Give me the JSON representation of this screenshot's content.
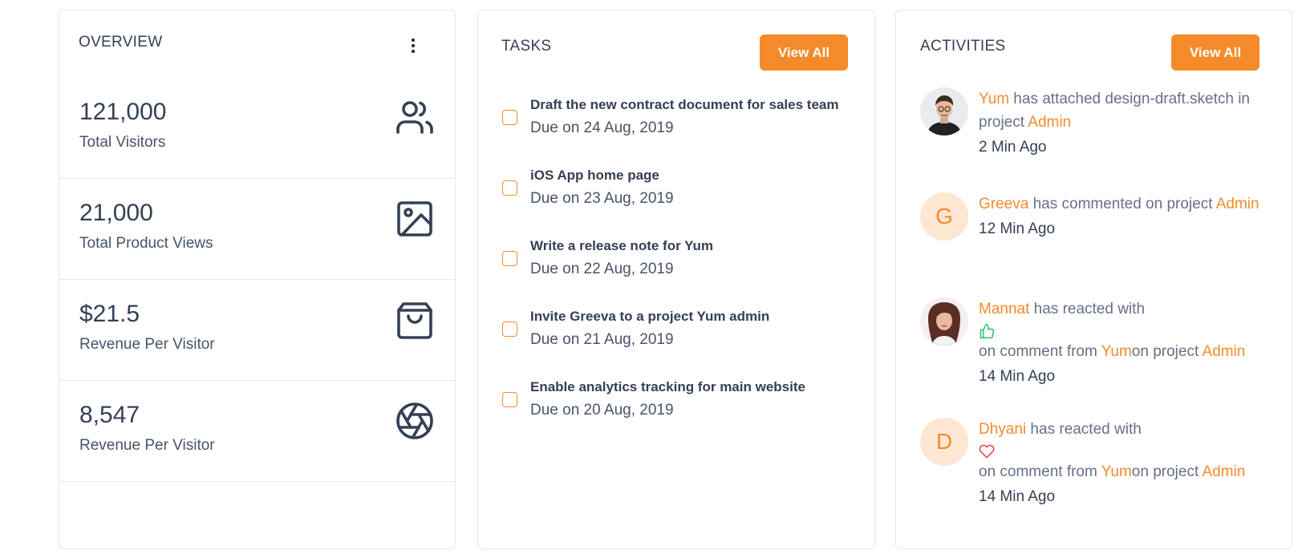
{
  "overview": {
    "title": "OVERVIEW",
    "stats": [
      {
        "value": "121,000",
        "label": "Total Visitors",
        "icon": "users-icon"
      },
      {
        "value": "21,000",
        "label": "Total Product Views",
        "icon": "image-icon"
      },
      {
        "value": "$21.5",
        "label": "Revenue Per Visitor",
        "icon": "shopping-bag-icon"
      },
      {
        "value": "8,547",
        "label": "Revenue Per Visitor",
        "icon": "aperture-icon"
      }
    ]
  },
  "tasks": {
    "title": "TASKS",
    "view_all": "View All",
    "items": [
      {
        "title": "Draft the new contract document for sales team",
        "due": "Due on 24 Aug, 2019"
      },
      {
        "title": "iOS App home page",
        "due": "Due on 23 Aug, 2019"
      },
      {
        "title": "Write a release note for Yum",
        "due": "Due on 22 Aug, 2019"
      },
      {
        "title": "Invite Greeva to a project Yum admin",
        "due": "Due on 21 Aug, 2019"
      },
      {
        "title": "Enable analytics tracking for main website",
        "due": "Due on 20 Aug, 2019"
      }
    ]
  },
  "activities": {
    "title": "ACTIVITIES",
    "view_all": "View All",
    "items": [
      {
        "user": "Yum",
        "text": " has attached design-draft.sketch in project ",
        "target": "Admin",
        "time": "2 Min Ago",
        "avatar": "photo-man"
      },
      {
        "user": "Greeva",
        "text": " has commented on project ",
        "target": "Admin",
        "time": "12 Min Ago",
        "avatar_letter": "G"
      },
      {
        "user": "Mannat",
        "text": " has reacted with",
        "reaction": "thumbs-up-icon",
        "text2": "on comment from ",
        "user2": "Yum",
        "text3": "on project ",
        "target": "Admin",
        "time": "14 Min Ago",
        "avatar": "photo-woman"
      },
      {
        "user": "Dhyani",
        "text": " has reacted with",
        "reaction": "heart-icon",
        "text2": "on comment from ",
        "user2": "Yum",
        "text3": "on project ",
        "target": "Admin",
        "time": "14 Min Ago",
        "avatar_letter": "D"
      }
    ]
  },
  "colors": {
    "accent": "#f58a2b",
    "text": "#344054",
    "muted": "#667085",
    "border": "#e4e7ec",
    "reaction_like": "#22c55e",
    "reaction_heart": "#ef4444"
  }
}
